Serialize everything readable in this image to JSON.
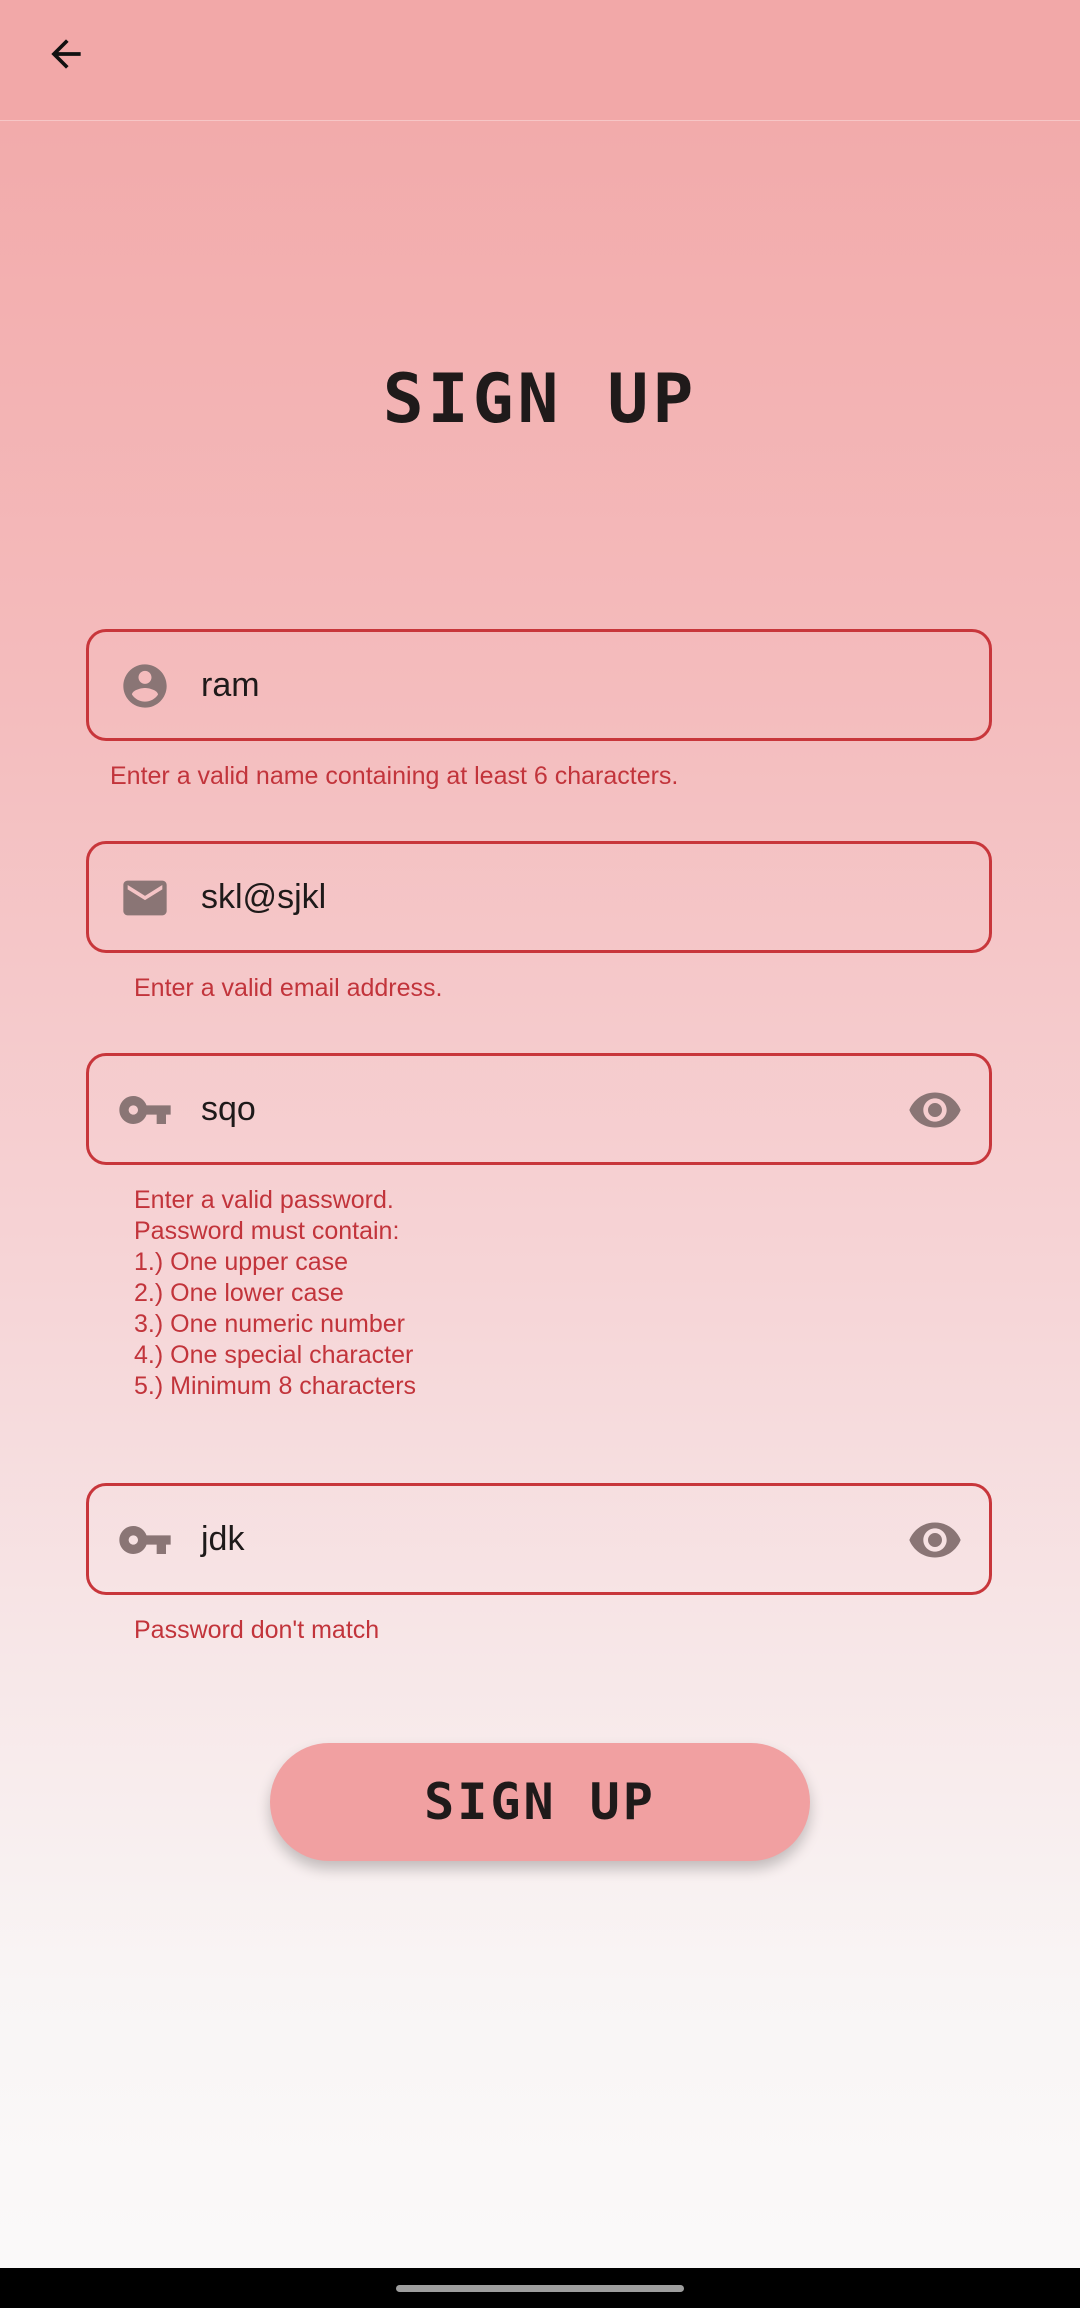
{
  "appbar": {
    "back_icon": "arrow-left-icon"
  },
  "page": {
    "title": "SIGN UP"
  },
  "form": {
    "name": {
      "value": "ram",
      "icon": "account-circle-icon",
      "error": "Enter a valid name containing at least 6 characters."
    },
    "email": {
      "value": "skl@sjkl",
      "icon": "mail-icon",
      "error": "Enter a valid email address."
    },
    "password": {
      "value": "sqo",
      "icon": "key-icon",
      "toggle_icon": "eye-icon",
      "error": "Enter a valid password.\nPassword must contain:\n1.) One upper case\n2.) One lower case\n3.) One numeric number\n4.) One special character\n5.) Minimum 8 characters"
    },
    "confirm_password": {
      "value": "jdk",
      "icon": "key-icon",
      "toggle_icon": "eye-icon",
      "error": "Password don't match"
    },
    "submit_label": "SIGN UP"
  },
  "colors": {
    "accent": "#c8363b",
    "error_text": "#c2343b",
    "appbar_bg": "#f2a8a8",
    "button_bg": "#f1a0a1",
    "icon_gray": "#8a7575"
  }
}
